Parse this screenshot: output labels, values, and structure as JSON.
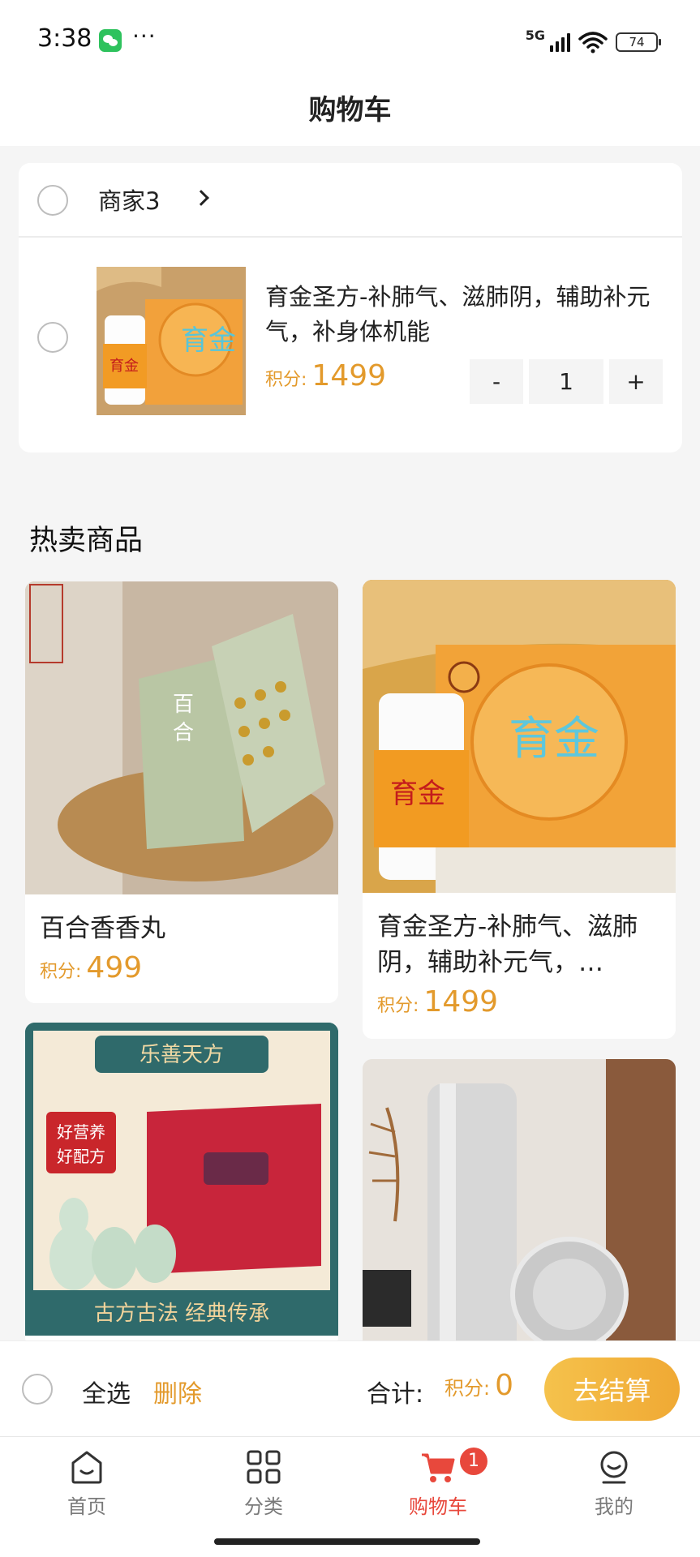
{
  "status_bar": {
    "time": "3:38",
    "more": "···",
    "network": "5G",
    "battery": "74"
  },
  "header": {
    "title": "购物车"
  },
  "cart": {
    "shop": {
      "name": "商家3"
    },
    "items": [
      {
        "title": "育金圣方-补肺气、滋肺阴，辅助补元气，补身体机能",
        "points_label": "积分:",
        "points": "1499",
        "quantity": "1",
        "minus": "-",
        "plus": "+",
        "image": "yujin-product-photo"
      }
    ]
  },
  "hot": {
    "title": "热卖商品",
    "products": [
      {
        "name": "百合香香丸",
        "points_label": "积分:",
        "points": "499",
        "image": "lily-box-photo"
      },
      {
        "name": "育金圣方-补肺气、滋肺阴，辅助补元气，…",
        "points_label": "积分:",
        "points": "1499",
        "image": "yujin-product-photo"
      },
      {
        "name": "",
        "image": "letian-fang-photo",
        "image_text": {
          "banner": "乐善天方",
          "badge_line1": "好营养",
          "badge_line2": "好配方",
          "footer": "古方古法  经典传承"
        }
      },
      {
        "name": "",
        "image": "silver-flask-photo"
      }
    ]
  },
  "checkout": {
    "select_all": "全选",
    "delete": "删除",
    "total_label": "合计:",
    "points_label": "积分:",
    "points": "0",
    "button": "去结算"
  },
  "tabbar": {
    "items": [
      {
        "label": "首页",
        "icon": "home-icon"
      },
      {
        "label": "分类",
        "icon": "grid-icon"
      },
      {
        "label": "购物车",
        "icon": "cart-icon",
        "active": true,
        "badge": "1"
      },
      {
        "label": "我的",
        "icon": "profile-icon"
      }
    ]
  },
  "colors": {
    "accent": "#e39a2c",
    "active_tab": "#e8483c",
    "checkout_btn": "#f0a934"
  }
}
